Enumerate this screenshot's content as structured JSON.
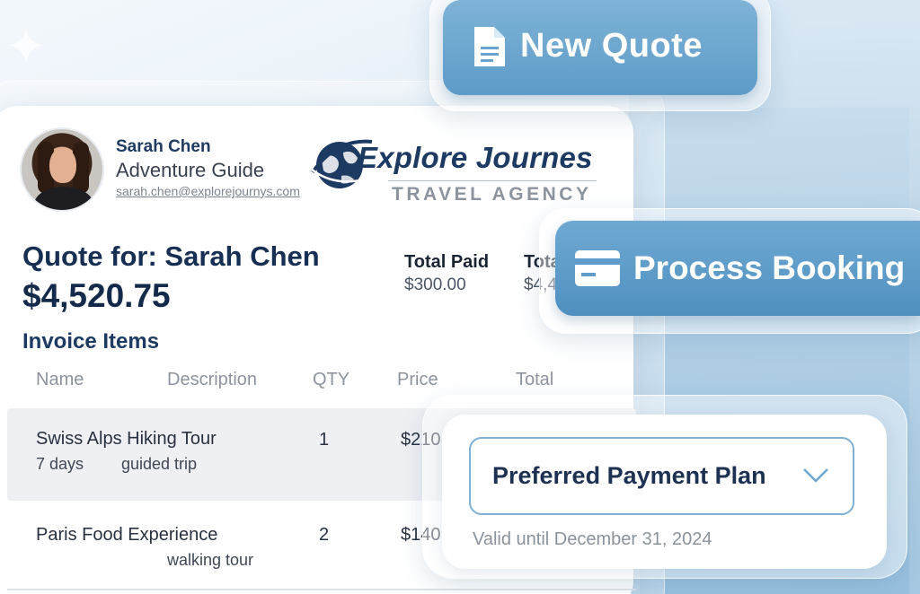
{
  "decor": {
    "sparkle": "✦"
  },
  "agent": {
    "name": "Sarah Chen",
    "role": "Adventure Guide",
    "email": "sarah.chen@explorejournys.com"
  },
  "brand": {
    "title": "Explore Journes",
    "subtitle": "TRAVEL AGENCY",
    "color": "#1d3a62"
  },
  "quote": {
    "title": "Quote for: Sarah Chen",
    "amount": "$4,520.75",
    "paid_label": "Total Paid",
    "paid_value": "$300.00",
    "total_label": "Total",
    "total_value": "$4,4"
  },
  "invoice": {
    "heading": "Invoice Items",
    "columns": [
      "Name",
      "Description",
      "QTY",
      "Price",
      "Total"
    ],
    "rows": [
      {
        "name": "Swiss Alps Hiking Tour",
        "sub_a": "7 days",
        "sub_b": "guided trip",
        "qty": "1",
        "price": "$210"
      },
      {
        "name": "Paris Food Experience",
        "sub_a": "",
        "sub_b": "walking tour",
        "qty": "2",
        "price": "$140"
      }
    ]
  },
  "actions": {
    "new_quote": "New Quote",
    "new_quote_icon": "document-icon",
    "process_booking": "Process Booking",
    "process_booking_icon": "credit-card-icon",
    "accent": "#5d9bc8"
  },
  "payment": {
    "selected": "Preferred Payment Plan",
    "valid_until": "Valid until December 31, 2024"
  }
}
